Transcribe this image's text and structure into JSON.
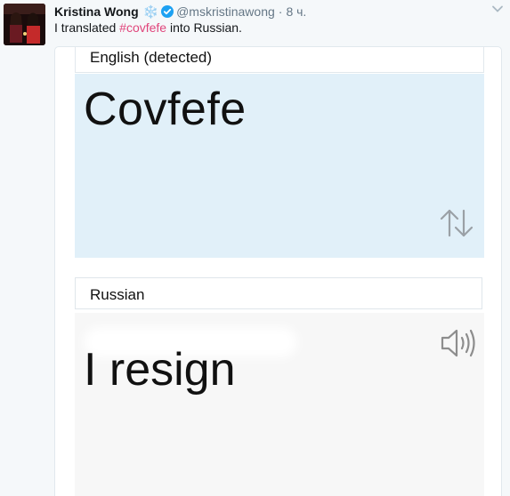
{
  "tweet": {
    "author_name": "Kristina Wong",
    "emoji": "❄️",
    "handle": "@mskristinawong",
    "separator": "·",
    "time": "8 ч.",
    "text_before": "I translated ",
    "hashtag": "#covfefe",
    "text_after": " into Russian."
  },
  "translator": {
    "source_language": "English (detected)",
    "source_text": "Covfefe",
    "target_language": "Russian",
    "target_text": "I resign"
  },
  "colors": {
    "hashtag": "#e0457b",
    "verified": "#1da1f2",
    "source_panel": "#e1f0f9",
    "target_panel": "#f7f7f7"
  },
  "icons": [
    "verified-badge-icon",
    "chevron-down-icon",
    "swap-languages-icon",
    "speaker-icon"
  ]
}
